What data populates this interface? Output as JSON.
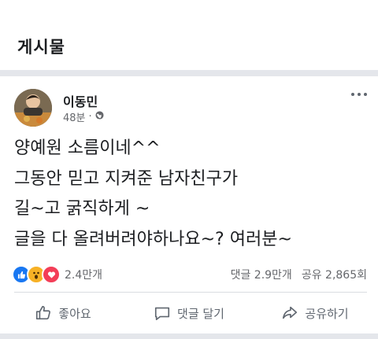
{
  "section": {
    "title": "게시물"
  },
  "post": {
    "author": "이동민",
    "time": "48분",
    "separator": "·",
    "text": "양예원 소름이네^^\n그동안 믿고 지켜준 남자친구가\n길~고 굵직하게 ~\n글을 다 올려버려야하나요~? 여러분~"
  },
  "reactions": {
    "count": "2.4만개",
    "types": [
      "like-icon",
      "wow-icon",
      "love-icon"
    ]
  },
  "stats": {
    "comments": "댓글 2.9만개",
    "shares": "공유 2,865회"
  },
  "actions": {
    "like": "좋아요",
    "comment": "댓글 달기",
    "share": "공유하기"
  },
  "colors": {
    "like": "#1877f2",
    "wow": "#f7b125",
    "love": "#f33e58",
    "divider": "#e4e6eb",
    "muted": "#65676b"
  }
}
